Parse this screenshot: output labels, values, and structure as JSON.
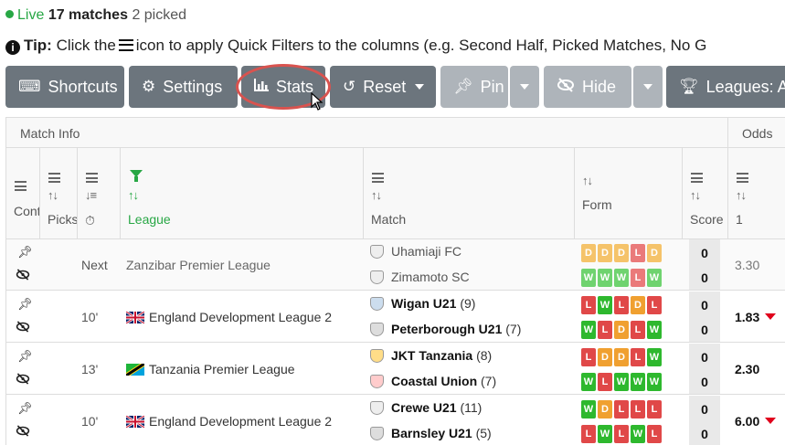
{
  "status": {
    "live_label": "Live",
    "matches": "17 matches",
    "picked": "2 picked"
  },
  "tip": {
    "label": "Tip:",
    "text_before": "Click the",
    "text_after": "icon to apply Quick Filters to the columns (e.g. Second Half, Picked Matches, No G"
  },
  "toolbar": {
    "shortcuts": "Shortcuts",
    "settings": "Settings",
    "stats": "Stats",
    "reset": "Reset",
    "pin": "Pin",
    "hide": "Hide",
    "leagues": "Leagues: Al"
  },
  "grid": {
    "groups": {
      "match_info": "Match Info",
      "odds": "Odds"
    },
    "headers": {
      "cont": "Cont",
      "picks": "Picks",
      "league": "League",
      "match": "Match",
      "form": "Form",
      "score": "Score",
      "odds1": "1"
    },
    "rows": [
      {
        "time": "Next",
        "league": "Zanzibar Premier League",
        "flag": "",
        "home": "Uhamiaji FC",
        "home_count": "",
        "away": "Zimamoto SC",
        "away_count": "",
        "home_form": [
          "D",
          "D",
          "D",
          "L",
          "D"
        ],
        "away_form": [
          "W",
          "W",
          "W",
          "L",
          "W"
        ],
        "score_home": "0",
        "score_away": "0",
        "odds": "3.30",
        "odds_down": false
      },
      {
        "time": "10'",
        "league": "England Development League 2",
        "flag": "uk",
        "home": "Wigan U21",
        "home_count": "(9)",
        "away": "Peterborough U21",
        "away_count": "(7)",
        "home_form": [
          "L",
          "W",
          "L",
          "D",
          "L"
        ],
        "away_form": [
          "W",
          "L",
          "D",
          "L",
          "W"
        ],
        "score_home": "0",
        "score_away": "0",
        "odds": "1.83",
        "odds_down": true
      },
      {
        "time": "13'",
        "league": "Tanzania Premier League",
        "flag": "tz",
        "home": "JKT Tanzania",
        "home_count": "(8)",
        "away": "Coastal Union",
        "away_count": "(7)",
        "home_form": [
          "L",
          "D",
          "D",
          "L",
          "W"
        ],
        "away_form": [
          "W",
          "L",
          "W",
          "W",
          "W"
        ],
        "score_home": "0",
        "score_away": "0",
        "odds": "2.30",
        "odds_down": false
      },
      {
        "time": "10'",
        "league": "England Development League 2",
        "flag": "uk",
        "home": "Crewe U21",
        "home_count": "(11)",
        "away": "Barnsley U21",
        "away_count": "(5)",
        "home_form": [
          "W",
          "D",
          "L",
          "L",
          "L"
        ],
        "away_form": [
          "L",
          "W",
          "L",
          "W",
          "L"
        ],
        "score_home": "0",
        "score_away": "0",
        "odds": "6.00",
        "odds_down": true
      }
    ]
  },
  "colors": {
    "live": "#28a745",
    "button": "#6c757d",
    "highlight": "#d9534f",
    "win": "#2eb82e",
    "loss": "#e04848",
    "draw": "#f0a030"
  }
}
